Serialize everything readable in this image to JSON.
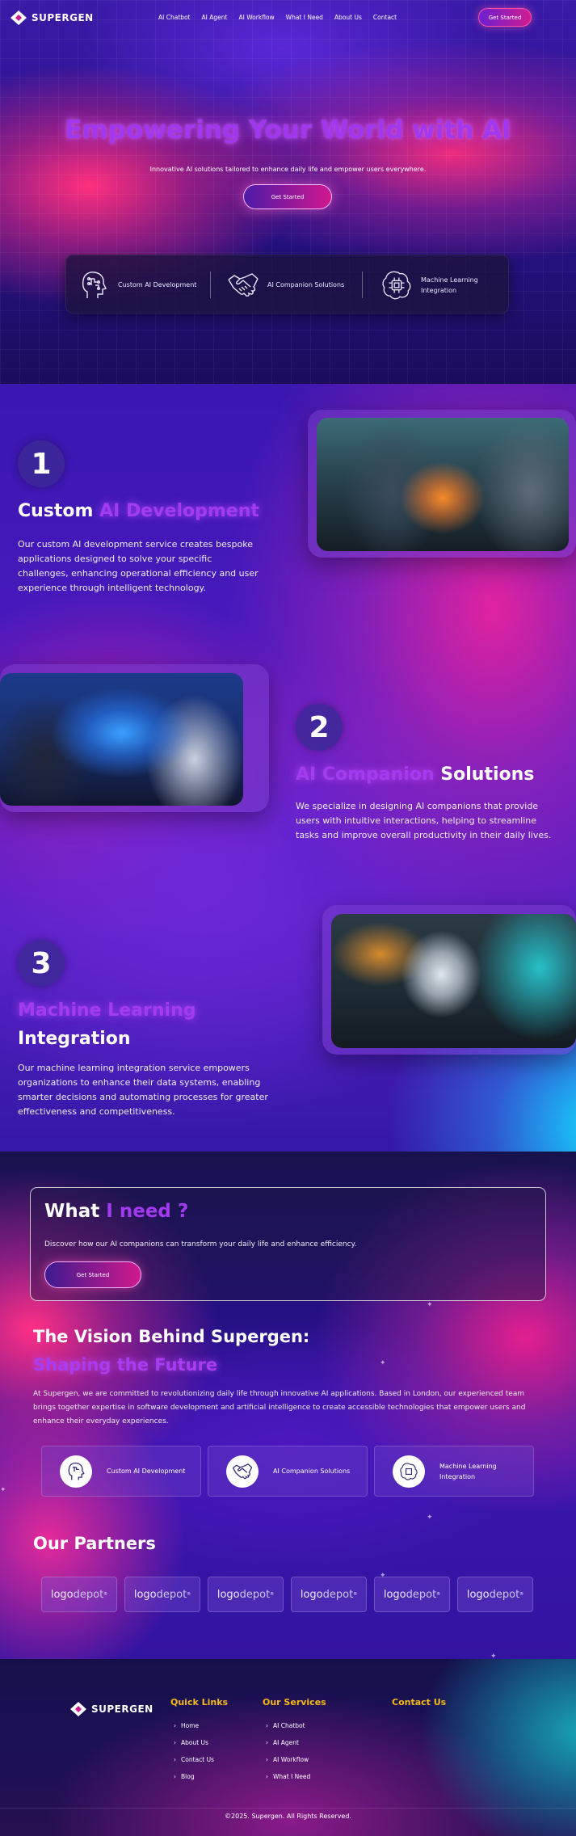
{
  "brand": {
    "name": "SUPERGEN"
  },
  "nav": {
    "links": [
      "AI Chatbot",
      "AI Agent",
      "AI Workflow",
      "What I Need",
      "About Us",
      "Contact"
    ],
    "cta": "Get Started"
  },
  "hero": {
    "title": "Empowering Your World with AI",
    "subtitle": "Innovative AI solutions tailored to enhance daily life and empower users everywhere.",
    "cta": "Get Started",
    "features": [
      {
        "label": "Custom AI Development",
        "icon": "circuit-head-icon"
      },
      {
        "label": "AI Companion Solutions",
        "icon": "handshake-icon"
      },
      {
        "label": "Machine Learning Integration",
        "icon": "chip-brain-icon"
      }
    ]
  },
  "services": [
    {
      "number": "1",
      "title_plain": "Custom ",
      "title_highlight": "AI Development",
      "title_rest": "",
      "description": "Our custom AI development service creates bespoke applications designed to solve your specific challenges, enhancing operational efficiency and user experience through intelligent technology."
    },
    {
      "number": "2",
      "title_plain": "",
      "title_highlight": "AI Companion",
      "title_rest": " Solutions",
      "description": "We specialize in designing AI companions that provide users with intuitive interactions, helping to streamline tasks and improve overall productivity in their daily lives."
    },
    {
      "number": "3",
      "title_plain": "",
      "title_highlight": "Machine Learning",
      "title_rest": "Integration",
      "description": "Our machine learning integration service empowers organizations to enhance their data systems, enabling smarter decisions and automating processes for greater effectiveness and competitiveness."
    }
  ],
  "need": {
    "title_plain": "What ",
    "title_highlight": "I need ?",
    "description": "Discover how our AI companions can transform your daily life and enhance efficiency.",
    "cta": "Get Started"
  },
  "vision": {
    "title": "The Vision Behind Supergen:",
    "subtitle": "Shaping the Future",
    "description": "At Supergen, we are committed to revolutionizing daily life through innovative AI applications. Based in London, our experienced team brings together expertise in software development and artificial intelligence to create accessible technologies that empower users and enhance their everyday experiences.",
    "cards": [
      {
        "label": "Custom AI Development",
        "icon": "circuit-head-icon"
      },
      {
        "label": "AI Companion Solutions",
        "icon": "handshake-icon"
      },
      {
        "label": "Machine Learning Integration",
        "icon": "chip-brain-icon"
      }
    ]
  },
  "partners": {
    "title": "Our Partners",
    "logos": [
      {
        "a": "logo",
        "b": "depot"
      },
      {
        "a": "logo",
        "b": "depot"
      },
      {
        "a": "logo",
        "b": "depot"
      },
      {
        "a": "logo",
        "b": "depot"
      },
      {
        "a": "logo",
        "b": "depot"
      },
      {
        "a": "logo",
        "b": "depot"
      }
    ]
  },
  "footer": {
    "quick_links_title": "Quick Links",
    "quick_links": [
      "Home",
      "About Us",
      "Contact Us",
      "Blog"
    ],
    "services_title": "Our Services",
    "services": [
      "AI Chatbot",
      "AI Agent",
      "AI Workflow",
      "What I Need"
    ],
    "contact_title": "Contact Us",
    "copyright": "©2025. Supergen. All Rights Reserved."
  },
  "colors": {
    "accent_purple": "#a33cf0",
    "accent_pink": "#d01d91",
    "footer_heading": "#f6b91a"
  }
}
